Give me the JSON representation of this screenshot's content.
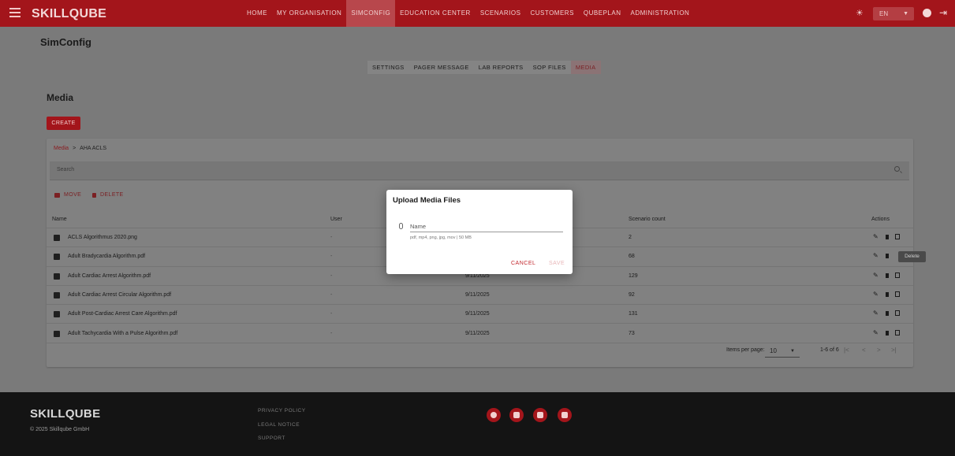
{
  "header": {
    "logo": "SKILLQUBE",
    "nav": [
      "HOME",
      "MY ORGANISATION",
      "SIMCONFIG",
      "EDUCATION CENTER",
      "SCENARIOS",
      "CUSTOMERS",
      "QUBEPLAN",
      "ADMINISTRATION"
    ],
    "active_nav": "SIMCONFIG",
    "language": "EN",
    "icons": [
      "menu-icon",
      "sun-icon",
      "account-icon",
      "logout-icon"
    ]
  },
  "page": {
    "title": "SimConfig",
    "subtabs": [
      "SETTINGS",
      "PAGER MESSAGE",
      "LAB REPORTS",
      "SOP FILES",
      "MEDIA"
    ],
    "active_subtab": "MEDIA",
    "section_title": "Media",
    "create_label": "CREATE"
  },
  "media": {
    "breadcrumb": {
      "root": "Media",
      "sep": ">",
      "current": "AHA ACLS"
    },
    "search_placeholder": "Search",
    "actions": {
      "move": "MOVE",
      "delete": "DELETE"
    },
    "columns": {
      "name": "Name",
      "user": "User",
      "scenario_count": "Scenario count",
      "actions": "Actions"
    },
    "rows": [
      {
        "name": "ACLS Algorithmus 2020.png",
        "user": "-",
        "date": "",
        "count": "2",
        "icon": "image-icon"
      },
      {
        "name": "Adult Bradycardia Algorithm.pdf",
        "user": "-",
        "date": "",
        "count": "68",
        "icon": "pdf-icon"
      },
      {
        "name": "Adult Cardiac Arrest Algorithm.pdf",
        "user": "-",
        "date": "9/11/2025",
        "count": "129",
        "icon": "pdf-icon"
      },
      {
        "name": "Adult Cardiac Arrest Circular Algorithm.pdf",
        "user": "-",
        "date": "9/11/2025",
        "count": "92",
        "icon": "pdf-icon"
      },
      {
        "name": "Adult Post-Cardiac Arrest Care Algorithm.pdf",
        "user": "-",
        "date": "9/11/2025",
        "count": "131",
        "icon": "pdf-icon"
      },
      {
        "name": "Adult Tachycardia With a Pulse Algorithm.pdf",
        "user": "-",
        "date": "9/11/2025",
        "count": "73",
        "icon": "pdf-icon"
      }
    ],
    "tooltip": "Delete",
    "pagination": {
      "items_per_page_label": "Items per page:",
      "items_per_page": "10",
      "range": "1-6 of 6"
    }
  },
  "dialog": {
    "title": "Upload Media Files",
    "name_placeholder": "Name",
    "hint": "pdf, mp4, png, jpg, mov | 50 MB",
    "cancel": "CANCEL",
    "save": "SAVE"
  },
  "footer": {
    "logo": "SKILLQUBE",
    "copyright": "© 2025 Skillqube GmbH",
    "links": [
      "PRIVACY POLICY",
      "LEGAL NOTICE",
      "SUPPORT"
    ],
    "social": [
      "facebook-icon",
      "instagram-icon",
      "linkedin-icon",
      "youtube-icon"
    ]
  },
  "colors": {
    "brand": "#a3151b",
    "overlay": "#7a7a7a",
    "footer": "#141414"
  }
}
